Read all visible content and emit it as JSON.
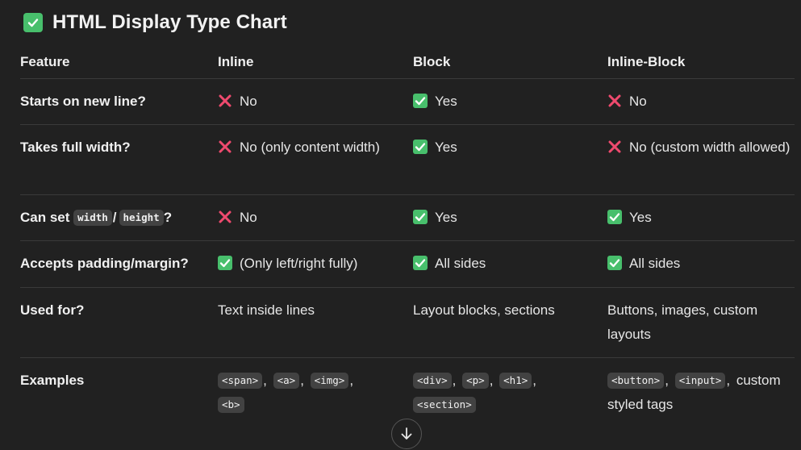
{
  "title": "HTML Display Type Chart",
  "title_icon": "check-box-icon",
  "colors": {
    "check": "#48bf6c",
    "cross": "#ef4a6e",
    "code_bg": "#424242",
    "background": "#212121"
  },
  "headers": [
    "Feature",
    "Inline",
    "Block",
    "Inline-Block"
  ],
  "rows": [
    {
      "feature": "Starts on new line?",
      "inline": {
        "mark": "cross",
        "text": "No"
      },
      "block": {
        "mark": "check",
        "text": "Yes"
      },
      "inline_block": {
        "mark": "cross",
        "text": "No"
      }
    },
    {
      "feature": "Takes full width?",
      "inline": {
        "mark": "cross",
        "text": "No (only content width)"
      },
      "block": {
        "mark": "check",
        "text": "Yes"
      },
      "inline_block": {
        "mark": "cross",
        "text": "No (custom width allowed)"
      }
    },
    {
      "feature_prefix": "Can set",
      "feature_code_1": "width",
      "feature_sep": "/",
      "feature_code_2": "height",
      "feature_suffix": "?",
      "inline": {
        "mark": "cross",
        "text": "No"
      },
      "block": {
        "mark": "check",
        "text": "Yes"
      },
      "inline_block": {
        "mark": "check",
        "text": "Yes"
      }
    },
    {
      "feature": "Accepts padding/margin?",
      "inline": {
        "mark": "check",
        "text": "(Only left/right fully)"
      },
      "block": {
        "mark": "check",
        "text": "All sides"
      },
      "inline_block": {
        "mark": "check",
        "text": "All sides"
      }
    },
    {
      "feature": "Used for?",
      "inline": {
        "text": "Text inside lines"
      },
      "block": {
        "text": "Layout blocks, sections"
      },
      "inline_block": {
        "text": "Buttons, images, custom layouts"
      }
    },
    {
      "feature": "Examples",
      "inline": {
        "codes": [
          "<span>",
          "<a>",
          "<img>",
          "<b>"
        ]
      },
      "block": {
        "codes": [
          "<div>",
          "<p>",
          "<h1>",
          "<section>"
        ]
      },
      "inline_block": {
        "codes": [
          "<button>",
          "<input>"
        ],
        "trailing": "custom styled tags"
      }
    }
  ],
  "scroll_button_icon": "arrow-down-icon"
}
